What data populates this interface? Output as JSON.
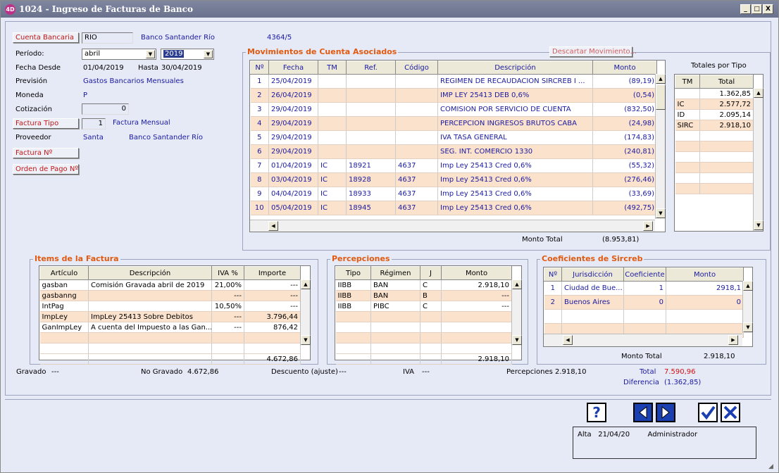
{
  "window": {
    "title": "1024 - Ingreso de Facturas de Banco",
    "logo": "4D",
    "min": "_",
    "max": "□",
    "close": "X"
  },
  "header": {
    "cuenta_bancaria_btn": "Cuenta Bancaria",
    "cuenta_value": "RIO",
    "banco_name": "Banco Santander Río",
    "cuenta_num": "4364/5",
    "periodo_label": "Período:",
    "periodo_mes": "abril",
    "periodo_anio": "2019",
    "fecha_desde_label": "Fecha Desde",
    "fecha_desde": "01/04/2019",
    "hasta_label": "Hasta",
    "hasta": "30/04/2019",
    "prevision_label": "Previsión",
    "prevision": "Gastos Bancarios Mensuales",
    "moneda_label": "Moneda",
    "moneda": "P",
    "cotizacion_label": "Cotización",
    "cotizacion": "0",
    "factura_tipo_btn": "Factura Tipo",
    "factura_tipo_num": "1",
    "factura_tipo": "Factura Mensual",
    "proveedor_label": "Proveedor",
    "proveedor_code": "Santa",
    "proveedor_name": "Banco Santander Río",
    "factura_nro_btn": "Factura Nº",
    "orden_pago_btn": "Orden de Pago Nº"
  },
  "movimientos": {
    "title": "Movimientos de Cuenta Asociados",
    "descartar_btn": "Descartar Movimiento...",
    "columns": [
      "Nº",
      "Fecha",
      "TM",
      "Ref.",
      "Código",
      "Descripción",
      "Monto"
    ],
    "rows": [
      [
        "1",
        "25/04/2019",
        "",
        "",
        "",
        "REGIMEN DE RECAUDACION SIRCREB I ...",
        "(89,19)"
      ],
      [
        "2",
        "26/04/2019",
        "",
        "",
        "",
        "IMP LEY 25413 DEB 0,6%",
        "(0,54)"
      ],
      [
        "3",
        "29/04/2019",
        "",
        "",
        "",
        "COMISION POR SERVICIO DE CUENTA",
        "(832,50)"
      ],
      [
        "4",
        "29/04/2019",
        "",
        "",
        "",
        "PERCEPCION INGRESOS BRUTOS CABA",
        "(24,98)"
      ],
      [
        "5",
        "29/04/2019",
        "",
        "",
        "",
        "IVA TASA GENERAL",
        "(174,83)"
      ],
      [
        "6",
        "29/04/2019",
        "",
        "",
        "",
        "SEG. INT. COMERCIO 1330",
        "(240,81)"
      ],
      [
        "7",
        "01/04/2019",
        "IC",
        "18921",
        "4637",
        "Imp Ley 25413 Cred 0,6%",
        "(55,32)"
      ],
      [
        "8",
        "03/04/2019",
        "IC",
        "18928",
        "4637",
        "Imp Ley 25413 Cred 0,6%",
        "(276,46)"
      ],
      [
        "9",
        "04/04/2019",
        "IC",
        "18933",
        "4637",
        "Imp Ley 25413 Cred 0,6%",
        "(33,69)"
      ],
      [
        "10",
        "05/04/2019",
        "IC",
        "18945",
        "4637",
        "Imp Ley 25413 Cred 0,6%",
        "(492,75)"
      ]
    ],
    "monto_total_label": "Monto Total",
    "monto_total": "(8.953,81)"
  },
  "totales": {
    "title": "Totales por Tipo",
    "columns": [
      "TM",
      "Total"
    ],
    "rows": [
      [
        "",
        "1.362,85"
      ],
      [
        "IC",
        "2.577,72"
      ],
      [
        "ID",
        "2.095,14"
      ],
      [
        "SIRC",
        "2.918,10"
      ],
      [
        "",
        ""
      ],
      [
        "",
        ""
      ],
      [
        "",
        ""
      ],
      [
        "",
        ""
      ],
      [
        "",
        ""
      ],
      [
        "",
        ""
      ]
    ]
  },
  "items": {
    "title": "Items de la Factura",
    "columns": [
      "Artículo",
      "Descripción",
      "IVA %",
      "Importe"
    ],
    "rows": [
      [
        "gasban",
        "Comisión Gravada abril de 2019",
        "21,00%",
        "---"
      ],
      [
        "gasbanng",
        "",
        "---",
        "---"
      ],
      [
        "IntPag",
        "",
        "10,50%",
        "---"
      ],
      [
        "ImpLey",
        "ImpLey 25413 Sobre Debitos",
        "---",
        "3.796,44"
      ],
      [
        "GanImpLey",
        "A cuenta del Impuesto a las Gan...",
        "---",
        "876,42"
      ],
      [
        "",
        "",
        "",
        ""
      ],
      [
        "",
        "",
        "",
        ""
      ]
    ],
    "total": "4.672,86"
  },
  "percepciones": {
    "title": "Percepciones",
    "columns": [
      "Tipo",
      "Régimen",
      "J",
      "Monto"
    ],
    "rows": [
      [
        "IIBB",
        "BAN",
        "C",
        "2.918,10"
      ],
      [
        "IIBB",
        "BAN",
        "B",
        "---"
      ],
      [
        "IIBB",
        "PIBC",
        "C",
        "---"
      ],
      [
        "",
        "",
        "",
        ""
      ],
      [
        "",
        "",
        "",
        ""
      ],
      [
        "",
        "",
        "",
        ""
      ],
      [
        "",
        "",
        "",
        ""
      ]
    ],
    "total": "2.918,10"
  },
  "coeficientes": {
    "title": "Coeficientes de Sircreb",
    "columns": [
      "Nº",
      "Jurisdicción",
      "Coeficiente",
      "Monto"
    ],
    "rows": [
      [
        "1",
        "Ciudad de Bue...",
        "1",
        "2918,1"
      ],
      [
        "2",
        "Buenos Aires",
        "0",
        "0"
      ],
      [
        "",
        "",
        "",
        ""
      ],
      [
        "",
        "",
        "",
        ""
      ]
    ],
    "monto_total_label": "Monto Total",
    "monto_total": "2.918,10"
  },
  "footer_totals": {
    "gravado_label": "Gravado",
    "gravado": "---",
    "no_gravado_label": "No Gravado",
    "no_gravado": "4.672,86",
    "descuento_label": "Descuento (ajuste)",
    "descuento": "---",
    "iva_label": "IVA",
    "iva": "---",
    "percepciones_label": "Percepciones",
    "percepciones": "2.918,10",
    "total_label": "Total",
    "total": "7.590,96",
    "diferencia_label": "Diferencia",
    "diferencia": "(1.362,85)"
  },
  "actions": {
    "help": "?",
    "audit": "Alta   21/04/20        Administrador"
  }
}
